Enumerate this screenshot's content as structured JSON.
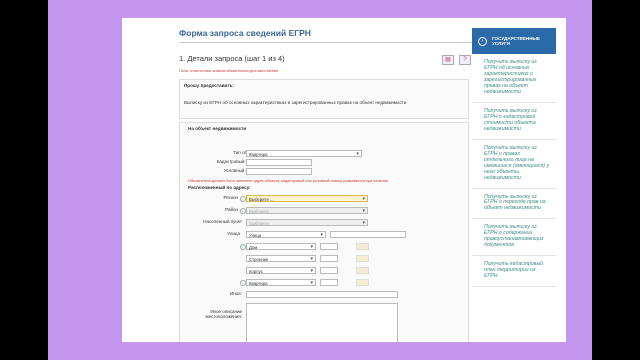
{
  "form": {
    "title": "Форма запроса сведений ЕГРН",
    "step": "1. Детали запроса (шаг 1 из 4)",
    "hint": "Поля, отмеченные знаком   обязательны для заполнения",
    "request_label": "Прошу предоставить:",
    "request_text": "Выписку из ЕГРН об основных характеристиках и зарегистрированных правах на объект недвижимости",
    "section_label": "На объект недвижимости",
    "object_type_label": "Тип объекта:",
    "object_type_value": "Квартира",
    "cadastral_label": "Кадастровый номер:",
    "conditional_label": "Условный номер:",
    "warning": "Обязательно должен быть заполнен адрес объекта, кадастровый или условный номер указывается при наличии",
    "address_label": "Расположенный по адресу:",
    "region_label": "Регион",
    "region_value": "Выберите ...",
    "district_label": "Район",
    "district_value": "Выберите",
    "locality_label": "Населенный пункт",
    "locality_value": "Выберите",
    "street_label": "Улица",
    "street_value": "Улица",
    "house_value": "Дом",
    "building_value": "Строение",
    "corpus_value": "Корпус",
    "flat_value": "Квартира",
    "other_label": "Иное:",
    "desc_label": "Иное описание местоположения:"
  },
  "sidebar": {
    "header": "ГОСУДАРСТВЕННЫЕ УСЛУГИ",
    "items": [
      "Получить выписку из ЕГРН об основных характеристиках и зарегистрированных правах на объект недвижимости",
      "Получить выписку из ЕГРН о кадастровой стоимости объекта недвижимости",
      "Получить выписку из ЕГРН о правах отдельного лица на имевшиеся (имеющиеся) у него объекты недвижимости",
      "Получить выписку из ЕГРН о переходе прав на объект недвижимости",
      "Получить выписку из ЕГРН о содержании правоустанавливающих документов",
      "Получить кадастровый план территории из ЕГРН"
    ]
  },
  "colors": {
    "frame": "#c596ee",
    "accent": "#2a6aa8",
    "link": "#3d8c86",
    "title": "#3a6797",
    "warning": "#cc3333"
  },
  "icons": [
    "print-icon",
    "help-icon",
    "chevron-down-icon",
    "info-icon",
    "circle-arrow-icon"
  ]
}
